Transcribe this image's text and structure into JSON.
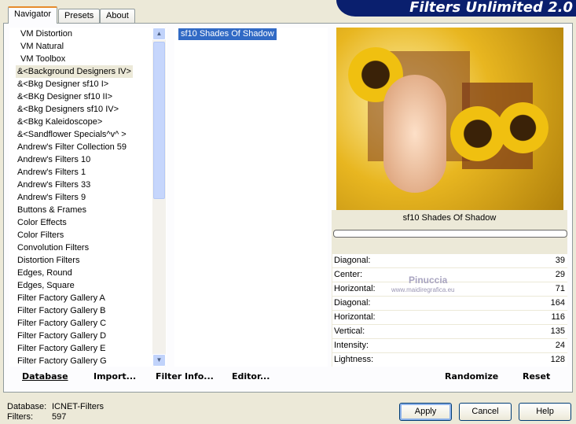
{
  "title": "Filters Unlimited 2.0",
  "tabs": [
    "Navigator",
    "Presets",
    "About"
  ],
  "categories": [
    "VM Distortion",
    "VM Natural",
    "VM Toolbox",
    "&<Background Designers IV>",
    "&<Bkg Designer sf10 I>",
    "&<BKg Designer sf10 II>",
    "&<Bkg Designers sf10 IV>",
    "&<Bkg Kaleidoscope>",
    "&<Sandflower Specials^v^ >",
    "Andrew's Filter Collection 59",
    "Andrew's Filters 10",
    "Andrew's Filters 1",
    "Andrew's Filters 33",
    "Andrew's Filters 9",
    "Buttons & Frames",
    "Color Effects",
    "Color Filters",
    "Convolution Filters",
    "Distortion Filters",
    "Edges, Round",
    "Edges, Square",
    "Filter Factory Gallery A",
    "Filter Factory Gallery B",
    "Filter Factory Gallery C",
    "Filter Factory Gallery D",
    "Filter Factory Gallery E",
    "Filter Factory Gallery G"
  ],
  "selected_category": "&<Background Designers IV>",
  "filters": [
    "sf10 Shades Of Shadow"
  ],
  "preview": {
    "caption": "sf10 Shades Of Shadow",
    "watermark": "Pinuccia",
    "watermark_url": "www.maidiregrafica.eu"
  },
  "params": [
    {
      "label": "Diagonal:",
      "value": "39"
    },
    {
      "label": "Center:",
      "value": "29"
    },
    {
      "label": "Horizontal:",
      "value": "71"
    },
    {
      "label": "Diagonal:",
      "value": "164"
    },
    {
      "label": "Horizontal:",
      "value": "116"
    },
    {
      "label": "Vertical:",
      "value": "135"
    },
    {
      "label": "Intensity:",
      "value": "24"
    },
    {
      "label": "Lightness:",
      "value": "128"
    }
  ],
  "left_buttons": {
    "database": "Database",
    "import": "Import...",
    "filter_info": "Filter Info...",
    "editor": "Editor..."
  },
  "right_buttons": {
    "randomize": "Randomize",
    "reset": "Reset"
  },
  "status": {
    "database_label": "Database:",
    "database_value": "ICNET-Filters",
    "filters_label": "Filters:",
    "filters_value": "597"
  },
  "dialog_buttons": {
    "apply": "Apply",
    "cancel": "Cancel",
    "help": "Help"
  }
}
